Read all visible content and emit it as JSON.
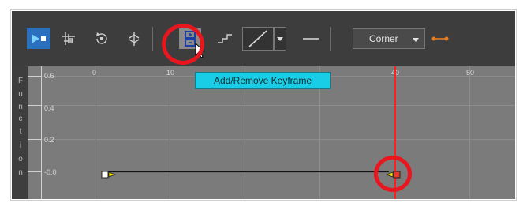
{
  "toolbar": {
    "corner_label": "Corner",
    "icons": [
      "play-toggle-icon",
      "grid-snap-icon",
      "rotate-keyframe-icon",
      "align-icon",
      "add-remove-keyframe-icon",
      "step-interpolation-icon",
      "linear-interpolation-icon",
      "dropdown-arrow-icon",
      "constant-line-icon",
      "bezier-handle-icon"
    ]
  },
  "tooltip": {
    "text": "Add/Remove Keyframe"
  },
  "function_panel": {
    "vertical_label": [
      "F",
      "u",
      "n",
      "c",
      "t",
      "i",
      "o",
      "n"
    ]
  },
  "graph": {
    "y_ticks": [
      "0.6",
      "0.4",
      "0.2",
      "-0.0"
    ],
    "x_ticks": [
      "0",
      "10",
      "40",
      "50"
    ]
  },
  "colors": {
    "highlight_ring": "#e8161f",
    "current_frame": "#ff1f1f",
    "tooltip_bg": "#19cde6"
  }
}
